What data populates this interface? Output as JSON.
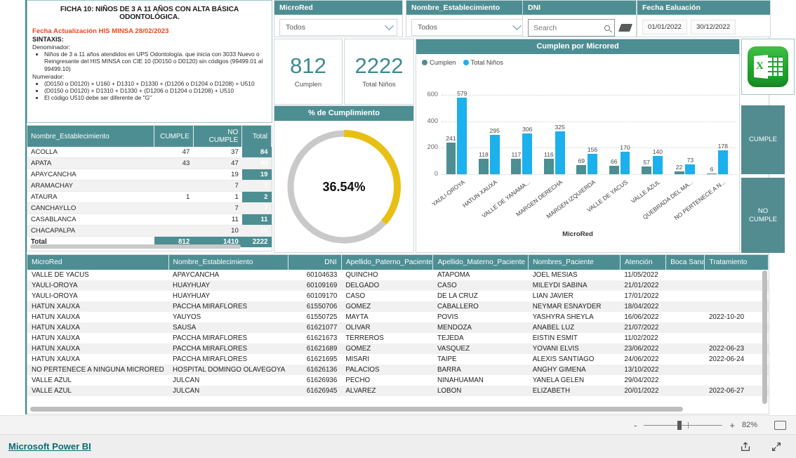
{
  "info_panel": {
    "title": "FICHA 10: NIÑOS DE 3 A 11 AÑOS CON ALTA BÁSICA ODONTOLÓGICA.",
    "update_date": "Fecha Actualización HIS MINSA 28/02/2023",
    "syntax_label": "SINTAXIS:",
    "denominator_label": "Denominador:",
    "denominator_items": [
      "Niños de 3 a 11 años atendidos en UPS Odontología. que inicia con 3033 Nuevo o Reingresante del HIS MINSA con CIE 10 (D0150 o D0120) sin códigos (99499.01 al 99499.10)"
    ],
    "numerator_label": "Numerador:",
    "numerator_items": [
      "(D0150 o D0120) + U160 + D1310 + D1330 + (D1206 o D1204 o D1208) + U510",
      "(D0150 o D0120) + D1310 + D1330 + (D1206 o D1204 o D1208) + U510",
      "El código U510 debe ser diferente de \"G\""
    ]
  },
  "slicers": {
    "microred": {
      "title": "MicroRed",
      "value": "Todos"
    },
    "establecimiento": {
      "title": "Nombre_Establecimiento",
      "value": "Todos"
    },
    "dni": {
      "title": "DNI",
      "placeholder": "Search",
      "search_icon": "search-icon",
      "clear_icon": "eraser-icon"
    },
    "fecha": {
      "title": "Fecha Ealuación",
      "start": "01/01/2022",
      "end": "30/12/2022"
    }
  },
  "kpis": [
    {
      "value": "812",
      "label": "Cumplen"
    },
    {
      "value": "2222",
      "label": "Total Niños"
    }
  ],
  "donut": {
    "title": "% de Cumplimiento",
    "percent_text": "36.54%",
    "percent_value": 36.54,
    "fill_color": "#e8c014",
    "track_color": "#c9c9c9"
  },
  "chart_data": {
    "type": "bar",
    "title": "Cumplen por Microred",
    "xlabel": "MicroRed",
    "ylabel": "",
    "ylim": [
      0,
      700
    ],
    "yticks": [
      0,
      200,
      400,
      600
    ],
    "grid": true,
    "legend_position": "top-left",
    "categories": [
      "YAULI-OROYA",
      "HATUN XAUXA",
      "VALLE DE YANAMA...",
      "MARGEN DERECHA",
      "MARGEN IZQUIERDA",
      "VALLE DE YACUS",
      "VALLE AZUL",
      "QUEBRADA DEL MA...",
      "NO PERTENECE A N..."
    ],
    "series": [
      {
        "name": "Cumplen",
        "color": "#4d8e93",
        "values": [
          241,
          118,
          117,
          116,
          69,
          66,
          57,
          22,
          6
        ]
      },
      {
        "name": "Total Niños",
        "color": "#1cb0ec",
        "values": [
          579,
          295,
          306,
          325,
          156,
          170,
          140,
          73,
          178
        ]
      }
    ]
  },
  "matrix": {
    "headers": [
      "Nombre_Establecimiento",
      "CUMPLE",
      "NO CUMPLE",
      "Total"
    ],
    "rows": [
      {
        "name": "ACOLLA",
        "cumple": "47",
        "no_cumple": "37",
        "total": "84"
      },
      {
        "name": "APATA",
        "cumple": "43",
        "no_cumple": "47",
        "total": "90"
      },
      {
        "name": "APAYCANCHA",
        "cumple": "",
        "no_cumple": "19",
        "total": "19"
      },
      {
        "name": "ARAMACHAY",
        "cumple": "",
        "no_cumple": "7",
        "total": "7"
      },
      {
        "name": "ATAURA",
        "cumple": "1",
        "no_cumple": "1",
        "total": "2"
      },
      {
        "name": "CANCHAYLLO",
        "cumple": "",
        "no_cumple": "7",
        "total": "7"
      },
      {
        "name": "CASABLANCA",
        "cumple": "",
        "no_cumple": "11",
        "total": "11"
      },
      {
        "name": "CHACAPALPA",
        "cumple": "",
        "no_cumple": "10",
        "total": "10"
      }
    ],
    "total_row": {
      "name": "Total",
      "cumple": "812",
      "no_cumple": "1410",
      "total": "2222"
    }
  },
  "side_buttons": {
    "excel_icon": "excel-export-icon",
    "cumple": "CUMPLE",
    "no_cumple": "NO\nCUMPLE"
  },
  "data_table": {
    "headers": [
      "MicroRed",
      "Nombre_Establecimiento",
      "DNI",
      "Apellido_Paterno_Paciente",
      "Apellido_Materno_Paciente",
      "Nombres_Paciente",
      "Atención",
      "Boca Sana",
      "Tratamiento"
    ],
    "rows": [
      [
        "VALLE DE YACUS",
        "APAYCANCHA",
        "60104633",
        "QUINCHO",
        "ATAPOMA",
        "JOEL MESIAS",
        "11/05/2022",
        "",
        ""
      ],
      [
        "YAULI-OROYA",
        "HUAYHUAY",
        "60109169",
        "DELGADO",
        "CASO",
        "MILEYDI SABINA",
        "21/01/2022",
        "",
        ""
      ],
      [
        "YAULI-OROYA",
        "HUAYHUAY",
        "60109170",
        "CASO",
        "DE LA CRUZ",
        "LIAN JAVIER",
        "17/01/2022",
        "",
        ""
      ],
      [
        "HATUN XAUXA",
        "PACCHA MIRAFLORES",
        "61550706",
        "GOMEZ",
        "CABALLERO",
        "NEYMAR ESNAYDER",
        "18/04/2022",
        "",
        ""
      ],
      [
        "HATUN XAUXA",
        "YAUYOS",
        "61550725",
        "MAYTA",
        "POVIS",
        "YASHYRA SHEYLA",
        "16/06/2022",
        "",
        "2022-10-20"
      ],
      [
        "HATUN XAUXA",
        "SAUSA",
        "61621077",
        "OLIVAR",
        "MENDOZA",
        "ANABEL LUZ",
        "21/07/2022",
        "",
        ""
      ],
      [
        "HATUN XAUXA",
        "PACCHA MIRAFLORES",
        "61621673",
        "TERREROS",
        "TEJEDA",
        "EISTIN ESMIT",
        "11/02/2022",
        "",
        ""
      ],
      [
        "HATUN XAUXA",
        "PACCHA MIRAFLORES",
        "61621689",
        "GOMEZ",
        "VASQUEZ",
        "YOVANI ELVIS",
        "23/06/2022",
        "",
        "2022-06-23"
      ],
      [
        "HATUN XAUXA",
        "PACCHA MIRAFLORES",
        "61621695",
        "MISARI",
        "TAIPE",
        "ALEXIS SANTIAGO",
        "24/06/2022",
        "",
        "2022-06-24"
      ],
      [
        "NO PERTENECE A NINGUNA MICRORED",
        "HOSPITAL DOMINGO OLAVEGOYA",
        "61626136",
        "PALACIOS",
        "BARRA",
        "ANGHY GIMENA",
        "13/10/2022",
        "",
        ""
      ],
      [
        "VALLE AZUL",
        "JULCAN",
        "61626936",
        "PECHO",
        "NINAHUAMAN",
        "YANELA GELEN",
        "29/04/2022",
        "",
        ""
      ],
      [
        "VALLE AZUL",
        "JULCAN",
        "61626945",
        "ALVAREZ",
        "LOBON",
        "ELIZABETH",
        "20/01/2022",
        "",
        "2022-06-27"
      ]
    ]
  },
  "zoom_bar": {
    "minus": "-",
    "plus": "+",
    "percent": "82%",
    "fit_icon": "fit-to-page-icon"
  },
  "footer": {
    "brand": "Microsoft Power BI",
    "share_icon": "share-icon",
    "fullscreen_icon": "fullscreen-icon"
  }
}
